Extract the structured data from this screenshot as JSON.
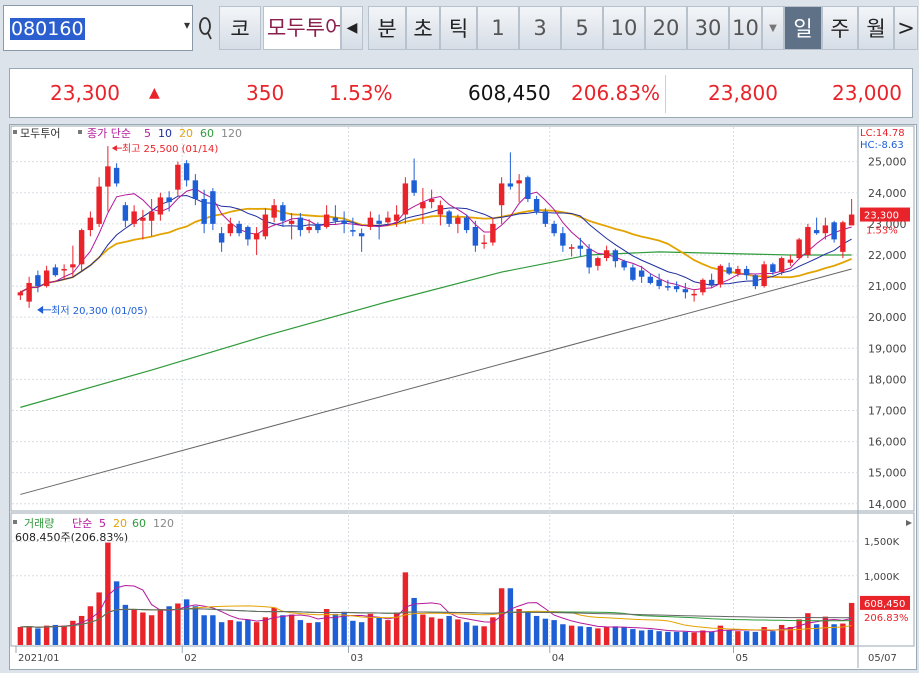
{
  "toolbar": {
    "code": "080160",
    "dropdown_glyph": "▾",
    "search_glyph": "Q",
    "market_label": "코",
    "stock_name": "모두투어",
    "prev_glyph": "◀",
    "interval_buttons": [
      "분",
      "초",
      "틱",
      "1",
      "3",
      "5",
      "10",
      "20",
      "30",
      "10"
    ],
    "interval_dropdown_glyph": "▼",
    "period_buttons": [
      "일",
      "주",
      "월"
    ],
    "next_glyph": ">"
  },
  "quote": {
    "price": "23,300",
    "arrow": "▲",
    "change": "350",
    "change_rate": "1.53%",
    "volume": "608,450",
    "volume_ratio": "206.83%",
    "high": "23,800",
    "low": "23,000"
  },
  "colors": {
    "up": "#e8232a",
    "down": "#1e5fd6",
    "ma5": "#b4199c",
    "ma10": "#1f2e9e",
    "ma20": "#e3a300",
    "ma60": "#2f9a3a",
    "ma120": "#666666",
    "price_label_bg": "#e8232a",
    "grid": "#d9dde3"
  },
  "price_panel": {
    "legend": {
      "stock_name": "모두투어",
      "ma_label": "종가 단순",
      "periods": [
        "5",
        "10",
        "20",
        "60",
        "120"
      ]
    },
    "lc_label": "LC:14.78",
    "hc_label": "HC:-8.63",
    "annotations": {
      "high": "최고 25,500 (01/14)",
      "low": "최저 20,300 (01/05)"
    },
    "y_ticks": [
      "25,000",
      "24,000",
      "23,000",
      "22,000",
      "21,000",
      "20,000",
      "19,000",
      "18,000",
      "17,000",
      "16,000",
      "15,000",
      "14,000"
    ],
    "current_price_label": "23,300",
    "current_change_label": "1.53%"
  },
  "volume_panel": {
    "legend": {
      "title": "거래량",
      "ma_label": "단순",
      "periods": [
        "5",
        "20",
        "60",
        "120"
      ]
    },
    "current_info": "608,450주(206.83%)",
    "y_ticks": [
      "1,500K",
      "1,000K"
    ],
    "current_volume_label": "608,450",
    "current_ratio_label": "206.83%"
  },
  "x_axis": {
    "month_labels": [
      "2021/01",
      "02",
      "03",
      "04",
      "05"
    ],
    "end_label": "05/07"
  },
  "chart_data": {
    "type": "candlestick",
    "ylim": [
      13800,
      25600
    ],
    "volume_ylim": [
      0,
      1850000
    ],
    "candles": [
      {
        "o": 20700,
        "h": 20850,
        "l": 20550,
        "c": 20800
      },
      {
        "o": 20500,
        "h": 21300,
        "l": 20300,
        "c": 21100
      },
      {
        "o": 21350,
        "h": 21500,
        "l": 20800,
        "c": 21000
      },
      {
        "o": 21000,
        "h": 21650,
        "l": 20950,
        "c": 21500
      },
      {
        "o": 21600,
        "h": 21700,
        "l": 21300,
        "c": 21350
      },
      {
        "o": 21500,
        "h": 21700,
        "l": 21200,
        "c": 21550
      },
      {
        "o": 21600,
        "h": 22300,
        "l": 21300,
        "c": 21700
      },
      {
        "o": 21700,
        "h": 22850,
        "l": 21500,
        "c": 22800
      },
      {
        "o": 22800,
        "h": 23400,
        "l": 22600,
        "c": 23200
      },
      {
        "o": 23000,
        "h": 24500,
        "l": 22900,
        "c": 24200
      },
      {
        "o": 24200,
        "h": 25500,
        "l": 23400,
        "c": 24850
      },
      {
        "o": 24800,
        "h": 24950,
        "l": 24200,
        "c": 24300
      },
      {
        "o": 23600,
        "h": 23700,
        "l": 22900,
        "c": 23100
      },
      {
        "o": 23000,
        "h": 23600,
        "l": 22900,
        "c": 23400
      },
      {
        "o": 23100,
        "h": 23450,
        "l": 22500,
        "c": 23200
      },
      {
        "o": 23100,
        "h": 23800,
        "l": 22600,
        "c": 23400
      },
      {
        "o": 23300,
        "h": 24000,
        "l": 23100,
        "c": 23850
      },
      {
        "o": 23850,
        "h": 24050,
        "l": 23400,
        "c": 23700
      },
      {
        "o": 24100,
        "h": 25000,
        "l": 23900,
        "c": 24900
      },
      {
        "o": 24950,
        "h": 25050,
        "l": 24200,
        "c": 24400
      },
      {
        "o": 24400,
        "h": 24600,
        "l": 23600,
        "c": 23800
      },
      {
        "o": 23800,
        "h": 24100,
        "l": 22700,
        "c": 23000
      },
      {
        "o": 24050,
        "h": 24150,
        "l": 22800,
        "c": 23000
      },
      {
        "o": 22700,
        "h": 22900,
        "l": 22100,
        "c": 22400
      },
      {
        "o": 22700,
        "h": 23200,
        "l": 22600,
        "c": 23000
      },
      {
        "o": 23000,
        "h": 23100,
        "l": 22600,
        "c": 22700
      },
      {
        "o": 22900,
        "h": 22950,
        "l": 22300,
        "c": 22500
      },
      {
        "o": 22500,
        "h": 22900,
        "l": 22000,
        "c": 22700
      },
      {
        "o": 22600,
        "h": 23500,
        "l": 22500,
        "c": 23300
      },
      {
        "o": 23200,
        "h": 23800,
        "l": 23050,
        "c": 23600
      },
      {
        "o": 23600,
        "h": 23700,
        "l": 22900,
        "c": 23100
      },
      {
        "o": 23000,
        "h": 23350,
        "l": 22500,
        "c": 23100
      },
      {
        "o": 23200,
        "h": 23350,
        "l": 22600,
        "c": 22800
      },
      {
        "o": 22800,
        "h": 23150,
        "l": 22700,
        "c": 22900
      },
      {
        "o": 23000,
        "h": 23050,
        "l": 22700,
        "c": 22800
      },
      {
        "o": 22900,
        "h": 23600,
        "l": 22850,
        "c": 23300
      },
      {
        "o": 23200,
        "h": 23600,
        "l": 23000,
        "c": 23100
      },
      {
        "o": 23100,
        "h": 23400,
        "l": 22700,
        "c": 23000
      },
      {
        "o": 22800,
        "h": 23200,
        "l": 22600,
        "c": 22750
      },
      {
        "o": 22700,
        "h": 22850,
        "l": 22100,
        "c": 22600
      },
      {
        "o": 22900,
        "h": 23400,
        "l": 22800,
        "c": 23200
      },
      {
        "o": 23100,
        "h": 23300,
        "l": 22500,
        "c": 23000
      },
      {
        "o": 23050,
        "h": 23400,
        "l": 22950,
        "c": 23200
      },
      {
        "o": 23100,
        "h": 23600,
        "l": 22900,
        "c": 23300
      },
      {
        "o": 23300,
        "h": 24500,
        "l": 23000,
        "c": 24300
      },
      {
        "o": 24400,
        "h": 25100,
        "l": 23900,
        "c": 24000
      },
      {
        "o": 23500,
        "h": 24150,
        "l": 23000,
        "c": 23700
      },
      {
        "o": 23700,
        "h": 24100,
        "l": 23500,
        "c": 23800
      },
      {
        "o": 23300,
        "h": 23750,
        "l": 22950,
        "c": 23600
      },
      {
        "o": 23400,
        "h": 23450,
        "l": 22900,
        "c": 23000
      },
      {
        "o": 23000,
        "h": 23300,
        "l": 22700,
        "c": 23200
      },
      {
        "o": 23200,
        "h": 23300,
        "l": 22700,
        "c": 22800
      },
      {
        "o": 22900,
        "h": 23100,
        "l": 22100,
        "c": 22300
      },
      {
        "o": 22400,
        "h": 22650,
        "l": 22200,
        "c": 22400
      },
      {
        "o": 22400,
        "h": 23200,
        "l": 22300,
        "c": 23000
      },
      {
        "o": 23600,
        "h": 24500,
        "l": 23000,
        "c": 24300
      },
      {
        "o": 24300,
        "h": 25300,
        "l": 24100,
        "c": 24200
      },
      {
        "o": 24300,
        "h": 24600,
        "l": 23700,
        "c": 24400
      },
      {
        "o": 24500,
        "h": 24550,
        "l": 23700,
        "c": 23800
      },
      {
        "o": 23800,
        "h": 23900,
        "l": 23300,
        "c": 23400
      },
      {
        "o": 23400,
        "h": 23500,
        "l": 22900,
        "c": 23000
      },
      {
        "o": 23000,
        "h": 23100,
        "l": 22600,
        "c": 22700
      },
      {
        "o": 22700,
        "h": 22900,
        "l": 22100,
        "c": 22300
      },
      {
        "o": 22200,
        "h": 22350,
        "l": 21950,
        "c": 22250
      },
      {
        "o": 22300,
        "h": 22550,
        "l": 21950,
        "c": 22200
      },
      {
        "o": 22200,
        "h": 22350,
        "l": 21400,
        "c": 21600
      },
      {
        "o": 21650,
        "h": 21950,
        "l": 21500,
        "c": 21900
      },
      {
        "o": 21900,
        "h": 22300,
        "l": 21800,
        "c": 22150
      },
      {
        "o": 22150,
        "h": 22200,
        "l": 21600,
        "c": 21800
      },
      {
        "o": 21800,
        "h": 21850,
        "l": 21500,
        "c": 21600
      },
      {
        "o": 21600,
        "h": 21700,
        "l": 21150,
        "c": 21200
      },
      {
        "o": 21500,
        "h": 21650,
        "l": 21100,
        "c": 21300
      },
      {
        "o": 21300,
        "h": 21400,
        "l": 21050,
        "c": 21100
      },
      {
        "o": 21200,
        "h": 21400,
        "l": 20900,
        "c": 21000
      },
      {
        "o": 21000,
        "h": 21200,
        "l": 20850,
        "c": 20950
      },
      {
        "o": 21000,
        "h": 21150,
        "l": 20800,
        "c": 20900
      },
      {
        "o": 20900,
        "h": 21100,
        "l": 20600,
        "c": 20800
      },
      {
        "o": 20700,
        "h": 20900,
        "l": 20500,
        "c": 20750
      },
      {
        "o": 20800,
        "h": 21250,
        "l": 20700,
        "c": 21200
      },
      {
        "o": 21200,
        "h": 21400,
        "l": 20950,
        "c": 21050
      },
      {
        "o": 21050,
        "h": 21700,
        "l": 20950,
        "c": 21650
      },
      {
        "o": 21600,
        "h": 21750,
        "l": 21350,
        "c": 21400
      },
      {
        "o": 21400,
        "h": 21650,
        "l": 21300,
        "c": 21550
      },
      {
        "o": 21550,
        "h": 21650,
        "l": 21200,
        "c": 21350
      },
      {
        "o": 21350,
        "h": 21400,
        "l": 20900,
        "c": 21000
      },
      {
        "o": 21000,
        "h": 21800,
        "l": 20950,
        "c": 21700
      },
      {
        "o": 21700,
        "h": 21750,
        "l": 21350,
        "c": 21450
      },
      {
        "o": 21450,
        "h": 21950,
        "l": 21350,
        "c": 21900
      },
      {
        "o": 21750,
        "h": 22000,
        "l": 21650,
        "c": 21850
      },
      {
        "o": 21900,
        "h": 22550,
        "l": 21850,
        "c": 22500
      },
      {
        "o": 22000,
        "h": 23000,
        "l": 21900,
        "c": 22900
      },
      {
        "o": 22800,
        "h": 23200,
        "l": 22650,
        "c": 22700
      },
      {
        "o": 22700,
        "h": 23200,
        "l": 22500,
        "c": 22950
      },
      {
        "o": 23050,
        "h": 23100,
        "l": 22400,
        "c": 22500
      },
      {
        "o": 22100,
        "h": 23100,
        "l": 21900,
        "c": 23050
      },
      {
        "o": 22950,
        "h": 23800,
        "l": 23000,
        "c": 23300
      }
    ],
    "volume": [
      260,
      270,
      240,
      280,
      290,
      280,
      350,
      420,
      560,
      760,
      1480,
      920,
      580,
      520,
      470,
      430,
      520,
      560,
      600,
      660,
      560,
      430,
      430,
      330,
      360,
      340,
      370,
      330,
      400,
      540,
      430,
      440,
      360,
      320,
      330,
      520,
      450,
      480,
      350,
      330,
      450,
      400,
      360,
      470,
      1050,
      680,
      440,
      400,
      380,
      420,
      370,
      330,
      280,
      270,
      400,
      820,
      820,
      520,
      480,
      420,
      380,
      360,
      300,
      280,
      270,
      260,
      240,
      260,
      270,
      260,
      230,
      210,
      220,
      200,
      190,
      190,
      190,
      180,
      210,
      190,
      280,
      210,
      200,
      200,
      190,
      260,
      200,
      290,
      260,
      370,
      460,
      300,
      410,
      300,
      310,
      608
    ],
    "ma120_start": 17100,
    "ma120_end": 21550,
    "ma60_points": [
      [
        0,
        17100
      ],
      [
        15,
        18300
      ],
      [
        28,
        19400
      ],
      [
        42,
        20500
      ],
      [
        55,
        21450
      ],
      [
        65,
        22000
      ],
      [
        73,
        22100
      ],
      [
        80,
        22050
      ],
      [
        88,
        22000
      ],
      [
        95,
        22000
      ]
    ]
  }
}
